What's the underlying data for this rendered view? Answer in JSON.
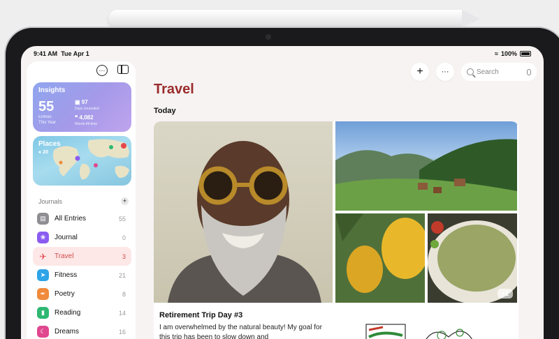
{
  "status_bar": {
    "time": "9:41 AM",
    "date": "Tue Apr 1",
    "battery": "100%"
  },
  "sidebar": {
    "insights": {
      "title": "Insights",
      "entries_count": "55",
      "entries_label": "Entries",
      "period_label": "This Year",
      "days_count": "97",
      "days_label": "Days Journaled",
      "words_count": "4,082",
      "words_label": "Words All-time"
    },
    "places": {
      "title": "Places",
      "count": "20"
    },
    "journals_header": "Journals",
    "journals": [
      {
        "label": "All Entries",
        "count": "55",
        "icon": "stack-icon",
        "color": "#8e8e93"
      },
      {
        "label": "Journal",
        "count": "0",
        "icon": "butterfly-icon",
        "color": "#8a5cf0"
      },
      {
        "label": "Travel",
        "count": "3",
        "icon": "airplane-icon",
        "color": "#e5484d",
        "active": true
      },
      {
        "label": "Fitness",
        "count": "21",
        "icon": "running-icon",
        "color": "#2fa4e7"
      },
      {
        "label": "Poetry",
        "count": "8",
        "icon": "feather-icon",
        "color": "#f08a3c"
      },
      {
        "label": "Reading",
        "count": "14",
        "icon": "book-icon",
        "color": "#2eb872"
      },
      {
        "label": "Dreams",
        "count": "16",
        "icon": "moon-icon",
        "color": "#e0478f"
      }
    ]
  },
  "toolbar": {
    "search_placeholder": "Search"
  },
  "main": {
    "title": "Travel",
    "section": "Today",
    "entry": {
      "title": "Retirement Trip Day #3",
      "body": "I am overwhelmed by the natural beauty! My goal for this trip has been to slow down and",
      "more_photos": "+1"
    }
  }
}
